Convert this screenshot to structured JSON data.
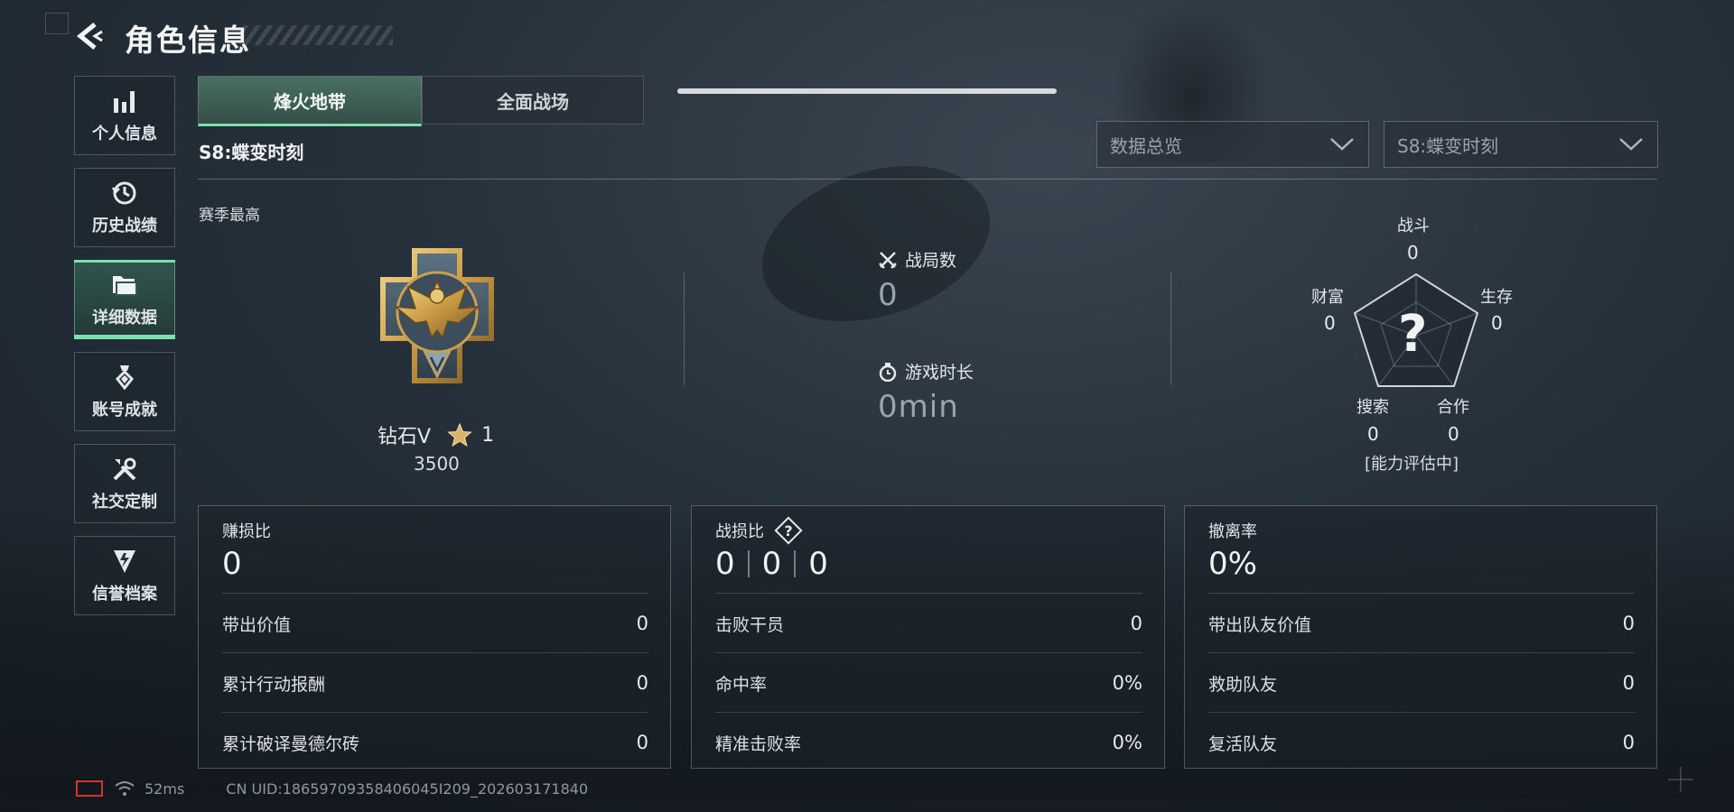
{
  "header": {
    "title": "角色信息"
  },
  "sidebar": {
    "items": [
      {
        "label": "个人信息",
        "icon": "bar-chart-icon"
      },
      {
        "label": "历史战绩",
        "icon": "history-clock-icon"
      },
      {
        "label": "详细数据",
        "icon": "folder-icon",
        "active": true
      },
      {
        "label": "账号成就",
        "icon": "achievement-medal-icon"
      },
      {
        "label": "社交定制",
        "icon": "wrench-tools-icon"
      },
      {
        "label": "信誉档案",
        "icon": "reputation-badge-icon"
      }
    ]
  },
  "tabs": [
    {
      "label": "烽火地带",
      "active": true
    },
    {
      "label": "全面战场",
      "active": false
    }
  ],
  "season": {
    "title": "S8:蝶变时刻",
    "best_label": "赛季最高"
  },
  "filters": {
    "view": {
      "value": "数据总览"
    },
    "season": {
      "value": "S8:蝶变时刻"
    }
  },
  "rank": {
    "name": "钻石V",
    "stars": "1",
    "score": "3500"
  },
  "stats": {
    "matches": {
      "label": "战局数",
      "value": "0"
    },
    "playtime": {
      "label": "游戏时长",
      "value": "0min"
    }
  },
  "radar": {
    "axes": [
      {
        "label": "战斗",
        "value": "0"
      },
      {
        "label": "生存",
        "value": "0"
      },
      {
        "label": "合作",
        "value": "0"
      },
      {
        "label": "搜索",
        "value": "0"
      },
      {
        "label": "财富",
        "value": "0"
      }
    ],
    "center": "?",
    "status": "[能力评估中]"
  },
  "panels": [
    {
      "title": "赚损比",
      "value": "0",
      "rows": [
        {
          "label": "带出价值",
          "value": "0"
        },
        {
          "label": "累计行动报酬",
          "value": "0"
        },
        {
          "label": "累计破译曼德尔砖",
          "value": "0"
        }
      ]
    },
    {
      "title": "战损比",
      "help": "?",
      "values": [
        "0",
        "0",
        "0"
      ],
      "rows": [
        {
          "label": "击败干员",
          "value": "0"
        },
        {
          "label": "命中率",
          "value": "0%"
        },
        {
          "label": "精准击败率",
          "value": "0%"
        }
      ]
    },
    {
      "title": "撤离率",
      "value": "0%",
      "rows": [
        {
          "label": "带出队友价值",
          "value": "0"
        },
        {
          "label": "救助队友",
          "value": "0"
        },
        {
          "label": "复活队友",
          "value": "0"
        }
      ]
    }
  ],
  "footer": {
    "ping": "52ms",
    "uid": "CN UID:18659709358406045I209_202603171840"
  },
  "colors": {
    "accent": "#7ce0b0",
    "battery_low": "#d0342c"
  }
}
